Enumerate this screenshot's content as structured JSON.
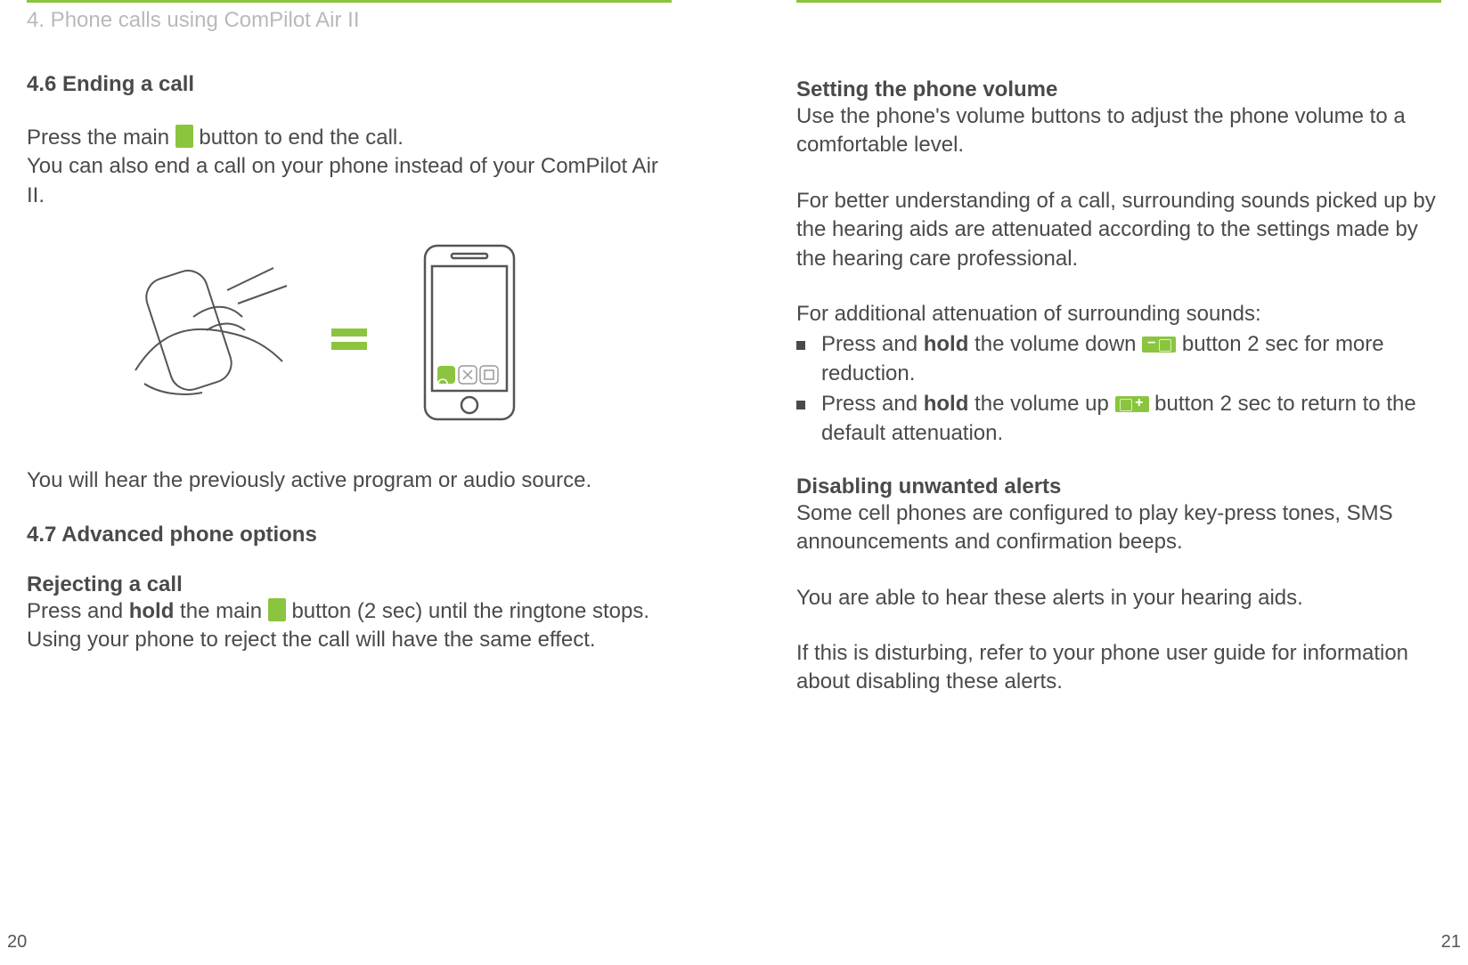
{
  "left": {
    "chapter": "4. Phone calls using ComPilot Air II",
    "sec46_title": "4.6 Ending a call",
    "p1a": "Press the main ",
    "p1b": " button to end the call.",
    "p2": "You can also end a call on your phone instead of your ComPilot Air II.",
    "p3": "You will hear the previously active program or audio source.",
    "sec47_title": "4.7 Advanced phone options",
    "sub_reject": "Rejecting a call",
    "p4a": "Press and ",
    "p4_hold": "hold",
    "p4b": " the main ",
    "p4c": " button (2 sec) until the ringtone stops. Using your phone to reject the call will have the same effect.",
    "pagenum": "20"
  },
  "right": {
    "sub_volume": "Setting the phone volume",
    "pv1": "Use the phone's volume buttons to adjust the phone volume to a comfortable level.",
    "pv2": "For better understanding of a call, surrounding sounds picked up by the hearing aids are attenuated according to the settings made by the hearing care professional.",
    "pv3": "For additional attenuation of surrounding sounds:",
    "b1a": "Press and ",
    "b1_hold": "hold",
    "b1b": " the volume down ",
    "b1c": " button 2 sec for more reduction.",
    "b2a": "Press and ",
    "b2_hold": "hold",
    "b2b": " the volume up ",
    "b2c": " button 2 sec to return to the default attenuation.",
    "sub_alerts": "Disabling unwanted alerts",
    "pa1": "Some cell phones are configured to play key-press tones, SMS announcements and confirmation beeps.",
    "pa2": "You are able to hear these alerts in your hearing aids.",
    "pa3": "If this is disturbing, refer to your phone user guide for information about disabling these alerts.",
    "pagenum": "21"
  }
}
